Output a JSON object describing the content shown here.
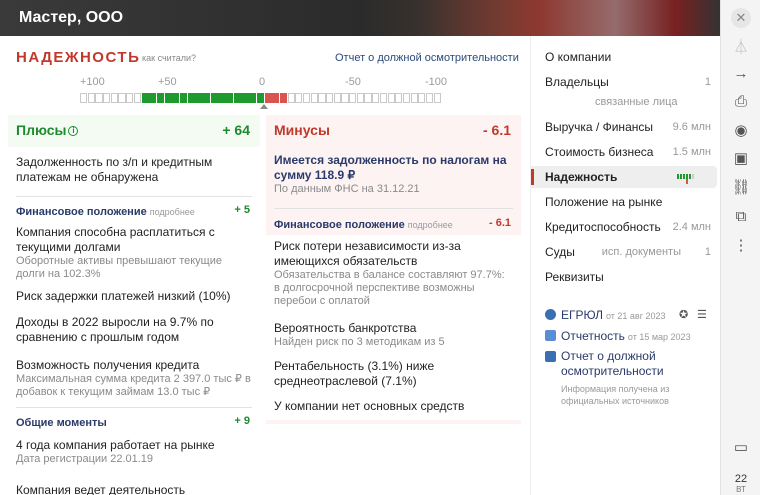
{
  "header": {
    "title": "Мастер, ООО"
  },
  "reliability": {
    "title": "НАДЕЖНОСТЬ",
    "how_link": "как считали?",
    "report_link": "Отчет о должной осмотрительности",
    "scale_labels": [
      "+100",
      "+50",
      "0",
      "-50",
      "-100"
    ],
    "scale_fraction": 0.12,
    "colors": {
      "positive": "#1e9a2e",
      "negative": "#d9534f",
      "accent": "#c0392b",
      "link": "#2a3a6a"
    }
  },
  "plus": {
    "title": "Плюсы",
    "info_icon": "i",
    "total": "+ 64",
    "top_item": "Задолженность по з/п и кредитным платежам не обнаружена",
    "sections": [
      {
        "title": "Финансовое положение",
        "more": "подробнее",
        "value": "+ 5",
        "items": [
          {
            "text": "Компания способна расплатиться с текущими долгами",
            "sub": "Оборотные активы превышают текущие долги на 102.3%"
          },
          {
            "text": "Риск задержки платежей низкий (10%)",
            "sub": ""
          },
          {
            "text": "Доходы в 2022 выросли на 9.7% по сравнению с прошлым годом",
            "sub": ""
          },
          {
            "text": "Возможность получения кредита",
            "sub": "Максимальная сумма кредита 2 397.0 тыс ₽ в добавок к текущим займам 13.0 тыс ₽"
          }
        ]
      },
      {
        "title": "Общие моменты",
        "more": "",
        "value": "+ 9",
        "items": [
          {
            "text": "4 года компания работает на рынке",
            "sub": "Дата регистрации 22.01.19"
          },
          {
            "text": "Компания ведет деятельность",
            "sub": ""
          }
        ]
      }
    ]
  },
  "minus": {
    "title": "Минусы",
    "total": "- 6.1",
    "top_item": {
      "text": "Имеется задолженность по налогам на сумму 118.9 ₽",
      "sub": "По данным ФНС на 31.12.21"
    },
    "sections": [
      {
        "title": "Финансовое положение",
        "more": "подробнее",
        "value": "- 6.1",
        "items": [
          {
            "text": "Риск потери независимости из-за имеющихся обязательств",
            "sub": "Обязательства в балансе составляют 97.7%: в долгосрочной перспективе возможны перебои с оплатой"
          },
          {
            "text": "Вероятность банкротства",
            "sub": "Найден риск по 3 методикам из 5"
          },
          {
            "text": "Рентабельность (3.1%) ниже среднеотраслевой (7.1%)",
            "sub": ""
          },
          {
            "text": "У компании нет основных средств",
            "sub": ""
          }
        ]
      }
    ]
  },
  "nav": {
    "items": [
      {
        "label": "О компании",
        "value": ""
      },
      {
        "label": "Владельцы",
        "value": "1"
      },
      {
        "label": "Выручка / Финансы",
        "value": "9.6 млн"
      },
      {
        "label": "Стоимость бизнеса",
        "value": "1.5 млн"
      },
      {
        "label": "Надежность",
        "value": ""
      },
      {
        "label": "Положение на рынке",
        "value": ""
      },
      {
        "label": "Кредитоспособность",
        "value": "2.4 млн"
      },
      {
        "label": "Суды",
        "value": "1"
      },
      {
        "label": "Реквизиты",
        "value": ""
      }
    ],
    "owners_sub": "связанные лица",
    "courts_sub": "исп. документы",
    "sources": [
      {
        "label": "ЕГРЮЛ",
        "date": "от 21 авг 2023"
      },
      {
        "label": "Отчетность",
        "date": "от 15 мар 2023"
      },
      {
        "label": "Отчет о должной осмотрительности",
        "date": ""
      }
    ],
    "note": "Информация получена из официальных источников"
  },
  "rail": {
    "date_day": "22",
    "date_month": "ВТ"
  }
}
